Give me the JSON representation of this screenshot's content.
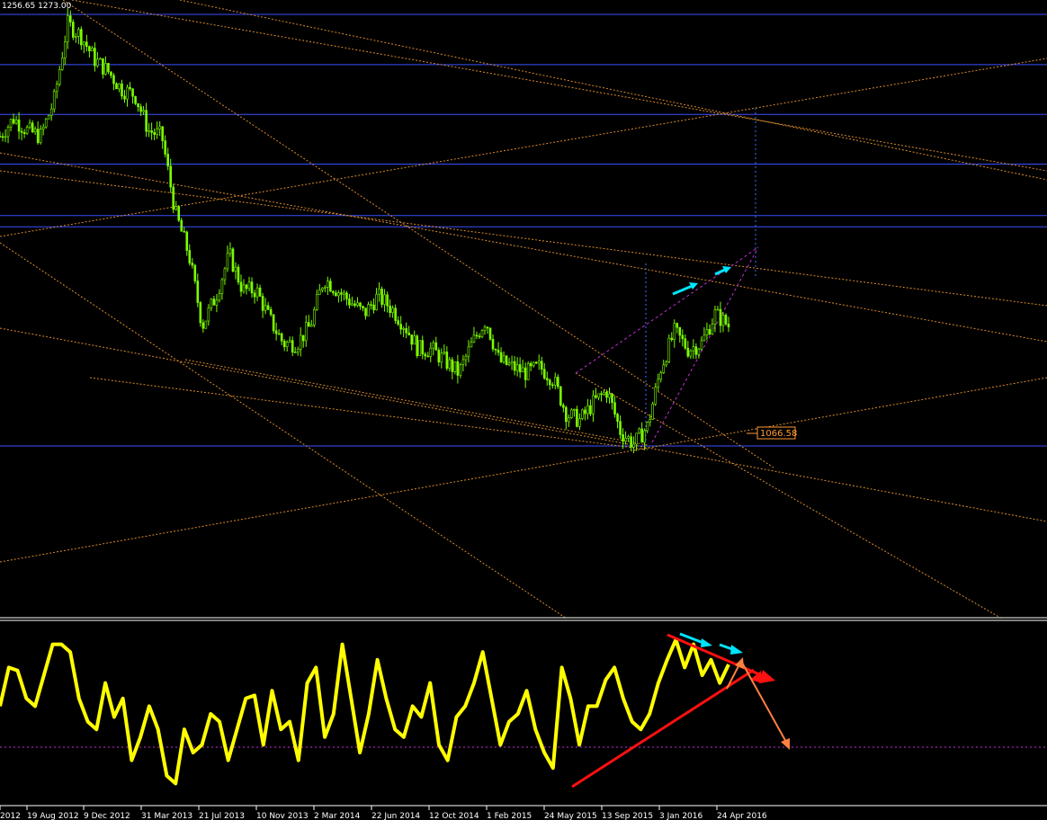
{
  "header": {
    "price_info": "1256.65 1273.00"
  },
  "price_label": "1066.58",
  "colors": {
    "background": "#000000",
    "candle": "#7cfc00",
    "hline": "#3a4fff",
    "trendline": "#d98c2b",
    "wedge": "#c22fd6",
    "oscillator": "#ffff00",
    "arrow_cyan": "#00e5ff",
    "arrow_red": "#ff1010",
    "arrow_orange": "#ff8040",
    "label_bg": "#ff9933"
  },
  "chart_data": [
    {
      "type": "line",
      "panel": "price",
      "x": [
        "2012-04-29",
        "2012-05-27",
        "2012-06-24",
        "2012-07-22",
        "2012-08-19",
        "2012-09-16",
        "2012-10-14",
        "2012-11-11",
        "2012-12-09",
        "2013-01-06",
        "2013-02-03",
        "2013-03-03",
        "2013-03-31",
        "2013-04-28",
        "2013-05-26",
        "2013-06-23",
        "2013-07-21",
        "2013-08-18",
        "2013-09-15",
        "2013-10-13",
        "2013-11-10",
        "2013-12-08",
        "2014-01-05",
        "2014-02-02",
        "2014-03-02",
        "2014-03-30",
        "2014-04-27",
        "2014-05-25",
        "2014-06-22",
        "2014-07-20",
        "2014-08-17",
        "2014-09-14",
        "2014-10-12",
        "2014-11-09",
        "2014-12-07",
        "2015-01-04",
        "2015-02-01",
        "2015-03-01",
        "2015-03-29",
        "2015-04-26",
        "2015-05-24",
        "2015-06-21",
        "2015-07-19",
        "2015-08-16",
        "2015-09-13",
        "2015-10-11",
        "2015-11-08",
        "2015-12-06",
        "2016-01-03",
        "2016-01-31",
        "2016-02-28",
        "2016-03-27",
        "2016-04-24",
        "2016-05-22"
      ],
      "values": [
        1590,
        1620,
        1600,
        1590,
        1650,
        1780,
        1760,
        1720,
        1700,
        1670,
        1660,
        1600,
        1590,
        1460,
        1390,
        1270,
        1320,
        1390,
        1330,
        1330,
        1280,
        1240,
        1240,
        1270,
        1350,
        1330,
        1310,
        1290,
        1320,
        1300,
        1270,
        1230,
        1230,
        1210,
        1190,
        1240,
        1280,
        1210,
        1200,
        1190,
        1200,
        1180,
        1120,
        1110,
        1140,
        1160,
        1090,
        1070,
        1100,
        1200,
        1260,
        1230,
        1240,
        1290,
        1270
      ],
      "horizontal_levels": [
        1796,
        1711,
        1627,
        1543,
        1456,
        1437,
        1066.58
      ],
      "x_tick_labels": [
        "2012",
        "19 Aug 2012",
        "9 Dec 2012",
        "31 Mar 2013",
        "21 Jul 2013",
        "10 Nov 2013",
        "2 Mar 2014",
        "22 Jun 2014",
        "12 Oct 2014",
        "1 Feb 2015",
        "24 May 2015",
        "13 Sep 2015",
        "3 Jan 2016",
        "24 Apr 2016"
      ],
      "last_value_label": "1066.58"
    },
    {
      "type": "line",
      "panel": "oscillator",
      "values": [
        55,
        80,
        78,
        60,
        55,
        75,
        95,
        95,
        90,
        60,
        45,
        40,
        70,
        48,
        60,
        20,
        35,
        55,
        40,
        10,
        5,
        40,
        25,
        30,
        50,
        45,
        20,
        40,
        60,
        62,
        30,
        65,
        40,
        45,
        20,
        70,
        80,
        35,
        50,
        95,
        60,
        25,
        50,
        85,
        60,
        40,
        35,
        55,
        48,
        70,
        30,
        20,
        48,
        55,
        70,
        90,
        60,
        30,
        45,
        50,
        65,
        40,
        25,
        15,
        80,
        60,
        30,
        55,
        55,
        72,
        80,
        60,
        45,
        40,
        50,
        70,
        85,
        98,
        80,
        95,
        75,
        85,
        70,
        82
      ]
    }
  ]
}
